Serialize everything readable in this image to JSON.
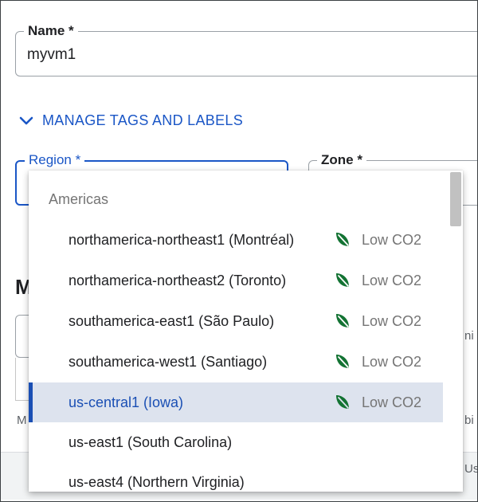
{
  "form": {
    "name_label": "Name *",
    "name_value": "myvm1",
    "manage_link": "MANAGE TAGS AND LABELS",
    "region_label": "Region *",
    "zone_label": "Zone *"
  },
  "background": {
    "heading_fragment": "M",
    "text_fragment": "M",
    "right_fragment_1": "ni",
    "right_fragment_2": "bi",
    "right_fragment_3": "Us"
  },
  "dropdown": {
    "group_header": "Americas",
    "options": [
      {
        "label": "northamerica-northeast1 (Montréal)",
        "badge": "Low CO2",
        "icon": "leaf-icon",
        "selected": false
      },
      {
        "label": "northamerica-northeast2 (Toronto)",
        "badge": "Low CO2",
        "icon": "leaf-icon",
        "selected": false
      },
      {
        "label": "southamerica-east1 (São Paulo)",
        "badge": "Low CO2",
        "icon": "leaf-icon",
        "selected": false
      },
      {
        "label": "southamerica-west1 (Santiago)",
        "badge": "Low CO2",
        "icon": "leaf-icon",
        "selected": false
      },
      {
        "label": "us-central1 (Iowa)",
        "badge": "Low CO2",
        "icon": "leaf-icon",
        "selected": true
      },
      {
        "label": "us-east1 (South Carolina)",
        "badge": "",
        "icon": "",
        "selected": false
      },
      {
        "label": "us-east4 (Northern Virginia)",
        "badge": "",
        "icon": "",
        "selected": false
      }
    ]
  },
  "colors": {
    "accent": "#1a56c6",
    "leaf": "#137333",
    "selected_bg": "#dde3ee"
  }
}
